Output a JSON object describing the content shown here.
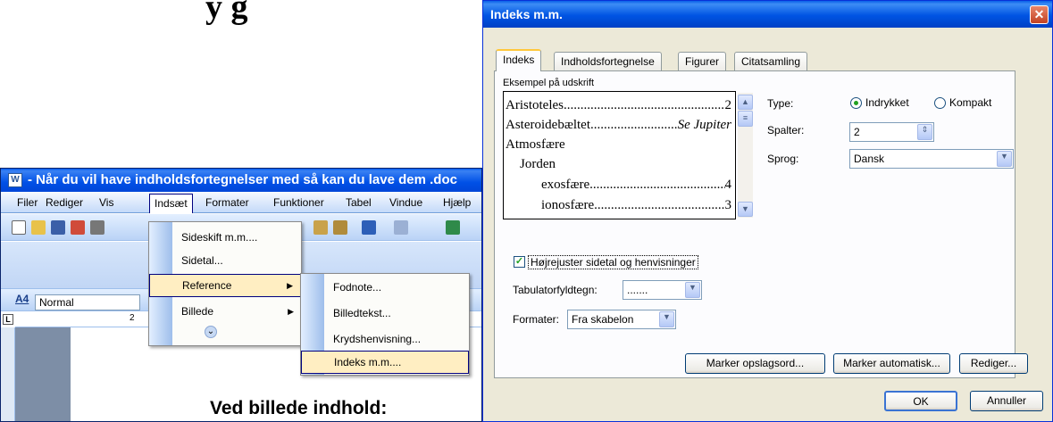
{
  "word": {
    "title": "- Når du vil have indholdsfortegnelser med så kan du lave dem .doc",
    "menu": [
      "Filer",
      "Rediger",
      "Vis",
      "Indsæt",
      "Formater",
      "Funktioner",
      "Tabel",
      "Vindue",
      "Hjælp"
    ],
    "style_value": "Normal",
    "ruler_mark": "2",
    "doc_heading": "Ved billede indhold:",
    "bg_heading": "y g"
  },
  "insert_menu": {
    "items": [
      {
        "label": "Sideskift m.m...."
      },
      {
        "label": "Sidetal..."
      },
      {
        "label": "Reference",
        "arrow": "▶"
      },
      {
        "label": "Billede",
        "arrow": "▶"
      }
    ],
    "more": "⌄"
  },
  "reference_menu": {
    "items": [
      {
        "label": "Fodnote..."
      },
      {
        "label": "Billedtekst..."
      },
      {
        "label": "Krydshenvisning..."
      },
      {
        "label": "Indeks m.m...."
      }
    ]
  },
  "dialog": {
    "title": "Indeks m.m.",
    "close": "✕",
    "tabs": [
      "Indeks",
      "Indholdsfortegnelse",
      "Figurer",
      "Citatsamling"
    ],
    "preview_label": "Eksempel på udskrift",
    "preview": [
      {
        "text": "Aristoteles",
        "num": "2"
      },
      {
        "text": "Asteroidebæltet",
        "num": "Se Jupiter"
      },
      {
        "text": "Atmosfære",
        "num": ""
      },
      {
        "text": "Jorden",
        "num": ""
      },
      {
        "text": "exosfære",
        "num": "4"
      },
      {
        "text": "ionosfære",
        "num": "3"
      }
    ],
    "type_label": "Type:",
    "type_options": [
      "Indrykket",
      "Kompakt"
    ],
    "type_selected": "Indrykket",
    "columns_label": "Spalter:",
    "columns_value": "2",
    "language_label": "Sprog:",
    "language_value": "Dansk",
    "right_align_label": "Højrejuster sidetal og henvisninger",
    "right_align_checked": true,
    "tab_leader_label": "Tabulatorfyldtegn:",
    "tab_leader_value": ".......",
    "formats_label": "Formater:",
    "formats_value": "Fra skabelon",
    "buttons": {
      "mark_entry": "Marker opslagsord...",
      "automark": "Marker automatisk...",
      "modify": "Rediger...",
      "ok": "OK",
      "cancel": "Annuller"
    }
  }
}
